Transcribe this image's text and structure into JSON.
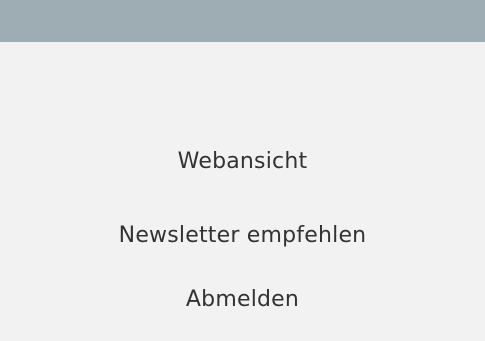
{
  "colors": {
    "header_bar": "#9eadb4",
    "background": "#f2f2f2",
    "link_text": "#333333"
  },
  "footer": {
    "links": [
      {
        "label": "Webansicht"
      },
      {
        "label": "Newsletter empfehlen"
      },
      {
        "label": "Abmelden"
      }
    ]
  }
}
